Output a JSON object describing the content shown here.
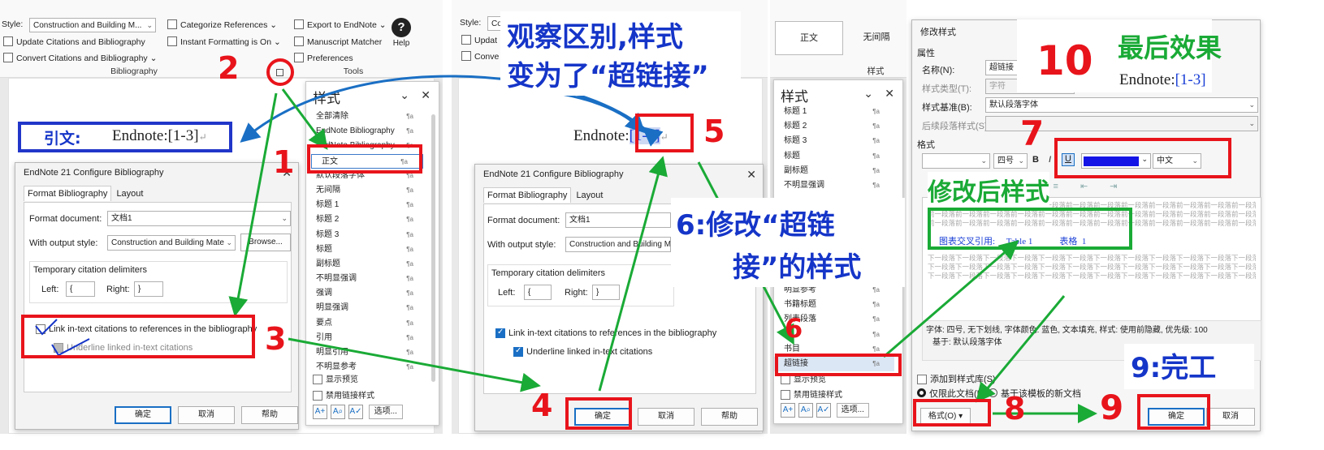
{
  "panel1": {
    "ribbon": {
      "style_label": "Style:",
      "style_value": "Construction and Building M...",
      "categorize": "Categorize References",
      "update": "Update Citations and Bibliography",
      "instant": "Instant Formatting is On",
      "convert": "Convert Citations and Bibliography",
      "export": "Export to EndNote",
      "manuscript": "Manuscript Matcher",
      "preferences": "Preferences",
      "help": "Help",
      "group_bibliography": "Bibliography",
      "group_tools": "Tools"
    },
    "citation_label": "引文:",
    "citation_text": "Endnote:[1-3]",
    "dialog": {
      "title": "EndNote 21 Configure Bibliography",
      "tab_format": "Format Bibliography",
      "tab_layout": "Layout",
      "format_document_label": "Format document:",
      "format_document_value": "文档1",
      "output_style_label": "With output style:",
      "output_style_value": "Construction and Building Mate",
      "browse": "Browse...",
      "delimiters_title": "Temporary citation delimiters",
      "left_label": "Left:",
      "left_value": "{",
      "right_label": "Right:",
      "right_value": "}",
      "link_checkbox": "Link in-text citations to references in the bibliography",
      "underline_checkbox": "Underline linked in-text citations",
      "ok": "确定",
      "cancel": "取消",
      "help": "帮助"
    },
    "stylepane": {
      "title": "样式",
      "items": [
        "全部清除",
        "EndNote Bibliography",
        "EndNote Bibliography",
        "正文",
        "默认段落字体",
        "无间隔",
        "标题 1",
        "标题 2",
        "标题 3",
        "标题",
        "副标题",
        "不明显强调",
        "强调",
        "明显强调",
        "要点",
        "引用",
        "明显引用",
        "不明显参考"
      ],
      "show_preview": "显示预览",
      "disable_linked": "禁用链接样式",
      "options": "选项..."
    }
  },
  "panel2": {
    "style_label": "Style:",
    "style_value": "Co",
    "update": "Updat",
    "convert": "Conve",
    "citation_prefix": "Endnote:",
    "citation_link": "[1-3]",
    "dialog": {
      "title": "EndNote 21 Configure Bibliography",
      "tab_format": "Format Bibliography",
      "tab_layout": "Layout",
      "format_document_label": "Format document:",
      "format_document_value": "文档1",
      "output_style_label": "With output style:",
      "output_style_value": "Construction and Building M",
      "delimiters_title": "Temporary citation delimiters",
      "left_label": "Left:",
      "left_value": "{",
      "right_label": "Right:",
      "right_value": "}",
      "link_checkbox": "Link in-text citations to references in the bibliography",
      "underline_checkbox": "Underline linked in-text citations",
      "ok": "确定",
      "cancel": "取消",
      "help": "帮助"
    }
  },
  "panel3": {
    "gallery": [
      "正文",
      "无间隔"
    ],
    "gallery_group": "样式",
    "stylepane": {
      "title": "样式",
      "items_top": [
        "标题 1",
        "标题 2",
        "标题 3",
        "标题",
        "副标题",
        "不明显强调"
      ],
      "items_bottom": [
        "明显参考",
        "书籍标题",
        "列表段落",
        "",
        "书目",
        "超链接"
      ],
      "show_preview": "显示预览",
      "disable_linked": "禁用链接样式",
      "options": "选项..."
    }
  },
  "panel4": {
    "dialog_title": "修改样式",
    "section_props": "属性",
    "name_label": "名称(N):",
    "name_value": "超链接",
    "type_label": "样式类型(T):",
    "type_value": "字符",
    "based_label": "样式基准(B):",
    "based_value": "默认段落字体",
    "next_label": "后续段落样式(S):",
    "section_format": "格式",
    "font_size": "四号",
    "lang": "中文",
    "preview_before": "前一段落前一段落前一段落前一段落前一段落前一段落前一段落前一段落前一段落前一段落前一段落前一段落前一段落",
    "preview_sample": "图表交叉引用:     Table 1            表格  1",
    "preview_after": "下一段落下一段落下一段落下一段落下一段落下一段落下一段落下一段落下一段落下一段落下一段落下一段落下一段落",
    "description": "字体: 四号, 无下划线, 字体颜色: 蓝色, 文本填充, 样式: 使用前隐藏, 优先级: 100",
    "description2": "基于: 默认段落字体",
    "add_to_gallery": "添加到样式库(S)",
    "only_this_doc": "仅限此文档(D)",
    "new_docs": "基于该模板的新文档",
    "format_button": "格式(O)",
    "ok": "确定",
    "cancel": "取消"
  },
  "annotations": {
    "n1": "1",
    "n2": "2",
    "n3": "3",
    "n4": "4",
    "n5": "5",
    "n6_small": "6",
    "n7": "7",
    "n8": "8",
    "n9": "9",
    "n10": "10",
    "observe_line1": "观察区别,样式",
    "observe_line2": "变为了“超链接”",
    "modify_line1": "6:修改“超链",
    "modify_line2": "接”的样式",
    "after_style": "修改后样式",
    "finish": "9:完工",
    "final_effect": "最后效果",
    "final_citation_prefix": "Endnote:",
    "final_citation_link": "[1-3]"
  },
  "colors": {
    "red": "#e8141b",
    "green": "#1aaa36",
    "blue": "#1535c8",
    "link": "#1a3fd6"
  }
}
